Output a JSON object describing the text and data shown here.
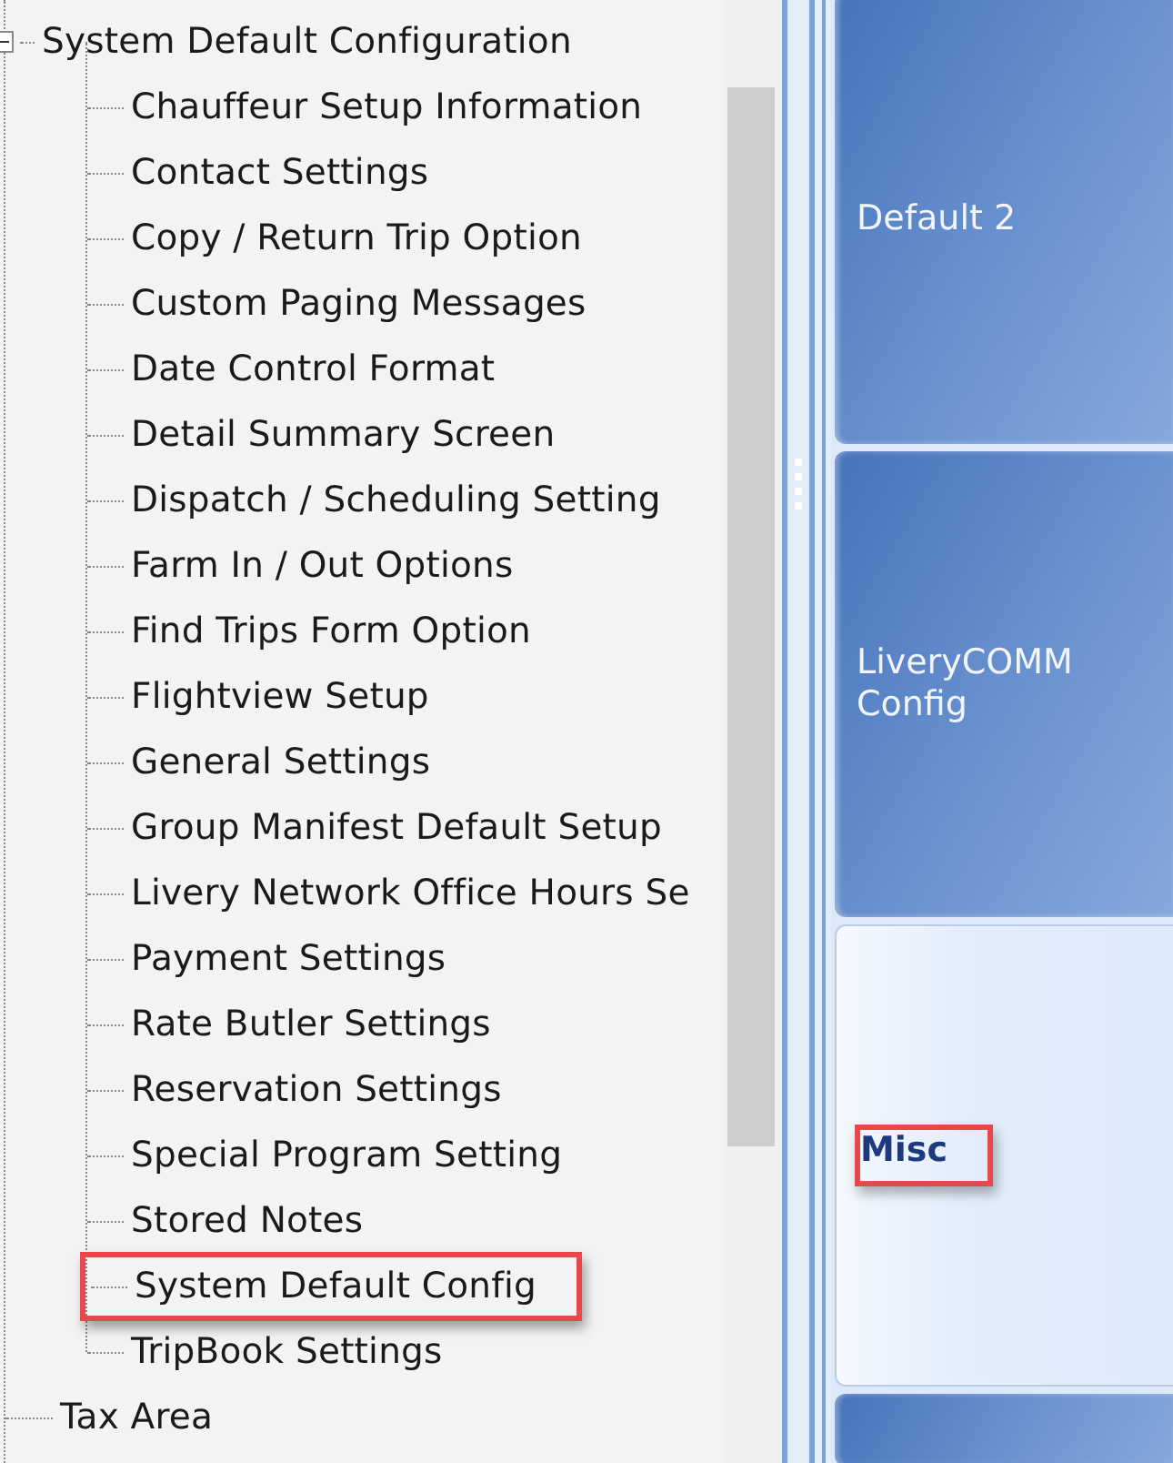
{
  "tree": {
    "items": [
      {
        "label": "System Default Configuration",
        "expanded": true,
        "highlighted": false,
        "children": [
          {
            "label": "Chauffeur Setup Information",
            "highlighted": false
          },
          {
            "label": "Contact Settings",
            "highlighted": false
          },
          {
            "label": "Copy / Return Trip Option",
            "highlighted": false
          },
          {
            "label": "Custom Paging Messages",
            "highlighted": false
          },
          {
            "label": "Date Control Format",
            "highlighted": false
          },
          {
            "label": "Detail Summary Screen",
            "highlighted": false
          },
          {
            "label": "Dispatch / Scheduling Setting",
            "highlighted": false
          },
          {
            "label": "Farm In / Out Options",
            "highlighted": false
          },
          {
            "label": "Find Trips Form Option",
            "highlighted": false
          },
          {
            "label": "Flightview Setup",
            "highlighted": false
          },
          {
            "label": "General Settings",
            "highlighted": false
          },
          {
            "label": "Group Manifest Default Setup",
            "highlighted": false
          },
          {
            "label": "Livery Network Office Hours Se",
            "highlighted": false
          },
          {
            "label": "Payment Settings",
            "highlighted": false
          },
          {
            "label": "Rate Butler Settings",
            "highlighted": false
          },
          {
            "label": "Reservation Settings",
            "highlighted": false
          },
          {
            "label": "Special Program Setting",
            "highlighted": false
          },
          {
            "label": "Stored Notes",
            "highlighted": false
          },
          {
            "label": "System Default Config",
            "highlighted": true
          },
          {
            "label": "TripBook Settings",
            "highlighted": false
          }
        ]
      },
      {
        "label": "Tax Area",
        "highlighted": false
      }
    ]
  },
  "tiles": [
    {
      "label": "Default 2",
      "selected": false,
      "highlighted": false
    },
    {
      "label": "LiveryCOMM Config",
      "selected": false,
      "highlighted": false
    },
    {
      "label": "Misc",
      "selected": true,
      "highlighted": true
    },
    {
      "selected": false,
      "highlighted": false
    }
  ]
}
